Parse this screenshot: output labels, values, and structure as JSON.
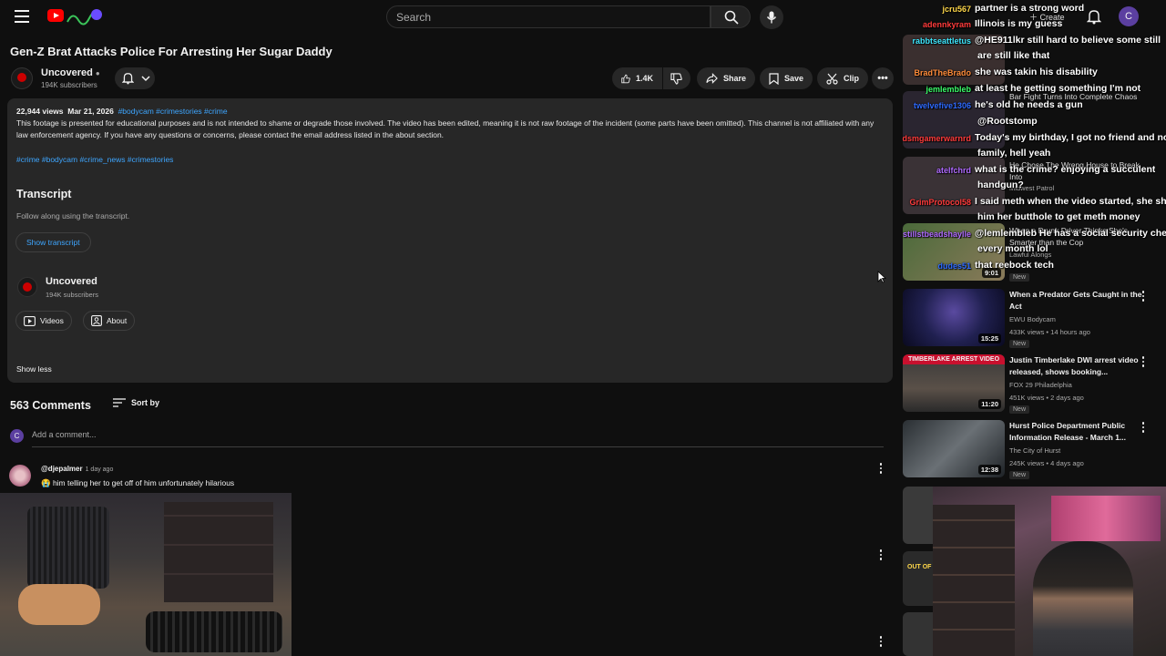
{
  "header": {
    "search_placeholder": "Search",
    "create_label": "Create",
    "avatar_initial": "C"
  },
  "video": {
    "title": "Gen-Z Brat Attacks Police For Arresting Her Sugar Daddy",
    "channel": "Uncovered",
    "subscribers": "194K subscribers",
    "likes": "1.4K",
    "share_label": "Share",
    "save_label": "Save",
    "clip_label": "Clip"
  },
  "description": {
    "views": "22,944 views",
    "date": "Mar 21, 2026",
    "hashtags": "#bodycam #crimestories #crime",
    "text": "This footage is presented for educational purposes and is not intended to shame or degrade those involved. The video has been edited, meaning it is not raw footage of the incident (some parts have been omitted). This channel is not affiliated with any law enforcement agency. If you have any questions or concerns, please contact the email address listed in the about section.",
    "tags_line": "#crime #bodycam #crime_news #crimestories",
    "transcript_heading": "Transcript",
    "transcript_sub": "Follow along using the transcript.",
    "show_transcript": "Show transcript",
    "channel_name": "Uncovered",
    "channel_subs": "194K subscribers",
    "videos_label": "Videos",
    "about_label": "About",
    "show_less": "Show less"
  },
  "comments": {
    "count": "563 Comments",
    "sort_label": "Sort by",
    "add_placeholder": "Add a comment...",
    "me_initial": "C",
    "items": [
      {
        "user": "@djepalmer",
        "ago": "1 day ago",
        "text": "😭 him telling her to get off of him unfortunately hilarious"
      }
    ]
  },
  "sidebar": {
    "items": [
      {
        "title": "When a Predator Gets Caught in the Act",
        "channel": "EWU Bodycam",
        "meta": "433K views • 14 hours ago",
        "badge": "New",
        "duration": "15:25"
      },
      {
        "title": "Justin Timberlake DWI arrest video released, shows booking...",
        "channel": "FOX 29 Philadelphia",
        "meta": "451K views • 2 days ago",
        "badge": "New",
        "duration": "11:20",
        "thumb_text": "TIMBERLAKE ARREST VIDEO"
      },
      {
        "title": "Hurst Police Department Public Information Release - March 1...",
        "channel": "The City of Hurst",
        "meta": "245K views • 4 days ago",
        "badge": "New",
        "duration": "12:38"
      }
    ],
    "partial": [
      {
        "text": "Bar Fight Turns Into Complete Chaos"
      },
      {
        "text": "He Chose The Wrong House to Break Into"
      },
      {
        "text": "Midwest Patrol"
      },
      {
        "text": "When a Drunk Driver Thinks She's Smarter than the Cop"
      },
      {
        "text": "Lawful Alongs"
      },
      {
        "text": "New"
      },
      {
        "text": "9:01"
      }
    ],
    "out_of_label": "OUT OF"
  },
  "chat": [
    {
      "user": "jcru567",
      "msg": "partner is a strong word",
      "color": "#ffd84a"
    },
    {
      "user": "adennkyram",
      "msg": "Illinois is my guess",
      "color": "#ff3b3b"
    },
    {
      "user": "rabbtseattletus",
      "msg": "@HE911lkr still hard to believe some still",
      "color": "#3ee8ff"
    },
    {
      "user": "",
      "msg": "are still like that",
      "color": "#ffffff"
    },
    {
      "user": "BradTheBrado",
      "msg": "she was takin his disability",
      "color": "#ff8c3a"
    },
    {
      "user": "jemlembleb",
      "msg": "at least he getting something I'm not",
      "color": "#3bff6b"
    },
    {
      "user": "twelvefive1306",
      "msg": "he's old he needs a gun",
      "color": "#2f6bff"
    },
    {
      "user": "",
      "msg": "@Rootstomp",
      "color": "#ffffff"
    },
    {
      "user": "dsmgamerwarnrd",
      "msg": "Today's my birthday, I got no friend and no",
      "color": "#ff3b3b"
    },
    {
      "user": "",
      "msg": "family, hell yeah",
      "color": "#ffffff"
    },
    {
      "user": "atelfchrd",
      "msg": "what is the crime? enjoying a succulent",
      "color": "#b06bff"
    },
    {
      "user": "",
      "msg": "handgun?",
      "color": "#ffffff"
    },
    {
      "user": "GrimProtocol58",
      "msg": "I said meth when the video started, she showed",
      "color": "#ff3b3b"
    },
    {
      "user": "",
      "msg": "him her butthole to get meth money",
      "color": "#ffffff"
    },
    {
      "user": "stillstbeadshaylle",
      "msg": "@lemlembleb He has a social security check",
      "color": "#b06bff"
    },
    {
      "user": "",
      "msg": "every month lol",
      "color": "#ffffff"
    },
    {
      "user": "dudes51",
      "msg": "that reebock tech",
      "color": "#2f6bff"
    }
  ]
}
